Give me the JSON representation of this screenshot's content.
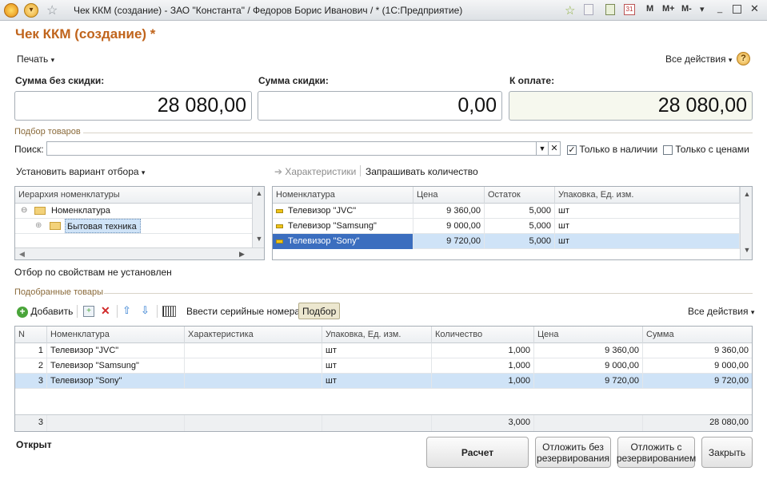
{
  "window": {
    "title": "Чек ККМ (создание) - ЗАО \"Константа\" / Федоров Борис Иванович / * (1С:Предприятие)",
    "tools": [
      "M",
      "M+",
      "M-"
    ]
  },
  "document": {
    "title": "Чек ККМ (создание) *",
    "print_label": "Печать",
    "all_actions_label": "Все действия",
    "help_label": "?"
  },
  "sums": {
    "without_discount_label": "Сумма без скидки:",
    "without_discount_value": "28 080,00",
    "discount_label": "Сумма скидки:",
    "discount_value": "0,00",
    "to_pay_label": "К оплате:",
    "to_pay_value": "28 080,00"
  },
  "selection": {
    "section_title": "Подбор товаров",
    "search_label": "Поиск:",
    "search_value": "",
    "only_in_stock_label": "Только в наличии",
    "only_in_stock_checked": true,
    "only_with_prices_label": "Только с ценами",
    "only_with_prices_checked": false,
    "set_filter_label": "Установить вариант отбора",
    "characteristics_label": "Характеристики",
    "ask_quantity_label": "Запрашивать количество",
    "filter_status": "Отбор по свойствам не установлен"
  },
  "hierarchy": {
    "header": "Иерархия номенклатуры",
    "items": [
      {
        "label": "Номенклатура",
        "level": 0
      },
      {
        "label": "Бытовая техника",
        "level": 1
      }
    ]
  },
  "products": {
    "columns": [
      "Номенклатура",
      "Цена",
      "Остаток",
      "Упаковка, Ед. изм."
    ],
    "rows": [
      {
        "name": "Телевизор \"JVC\"",
        "price": "9 360,00",
        "stock": "5,000",
        "unit": "шт"
      },
      {
        "name": "Телевизор \"Samsung\"",
        "price": "9 000,00",
        "stock": "5,000",
        "unit": "шт"
      },
      {
        "name": "Телевизор \"Sony\"",
        "price": "9 720,00",
        "stock": "5,000",
        "unit": "шт"
      }
    ]
  },
  "picked": {
    "section_title": "Подобранные товары",
    "add_label": "Добавить",
    "serials_label": "Ввести серийные номера",
    "pick_label": "Подбор",
    "all_actions_label": "Все действия",
    "columns": [
      "N",
      "Номенклатура",
      "Характеристика",
      "Упаковка, Ед. изм.",
      "Количество",
      "Цена",
      "Сумма"
    ],
    "rows": [
      {
        "n": "1",
        "name": "Телевизор \"JVC\"",
        "char": "",
        "unit": "шт",
        "qty": "1,000",
        "price": "9 360,00",
        "sum": "9 360,00"
      },
      {
        "n": "2",
        "name": "Телевизор \"Samsung\"",
        "char": "",
        "unit": "шт",
        "qty": "1,000",
        "price": "9 000,00",
        "sum": "9 000,00"
      },
      {
        "n": "3",
        "name": "Телевизор \"Sony\"",
        "char": "",
        "unit": "шт",
        "qty": "1,000",
        "price": "9 720,00",
        "sum": "9 720,00"
      }
    ],
    "footer": {
      "n": "3",
      "qty": "3,000",
      "sum": "28 080,00"
    }
  },
  "footer": {
    "status": "Открыт",
    "calc_label": "Расчет",
    "postpone_no_reserve_label": "Отложить без резервирования",
    "postpone_reserve_label": "Отложить с резервированием",
    "close_label": "Закрыть"
  },
  "colors": {
    "accent_title": "#c0641c",
    "selected_row": "#cfe3f7",
    "selected_cell": "#3b6ebf"
  }
}
